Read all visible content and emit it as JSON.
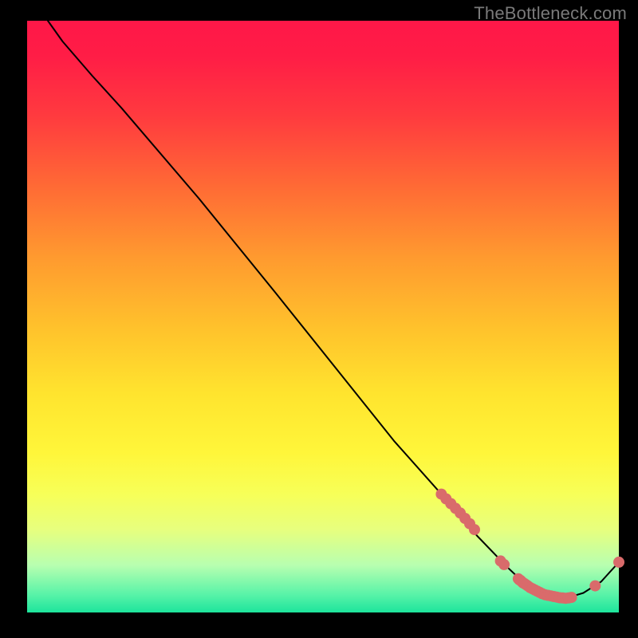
{
  "watermark": "TheBottleneck.com",
  "chart_data": {
    "type": "line",
    "title": "",
    "xlabel": "",
    "ylabel": "",
    "xlim": [
      0,
      100
    ],
    "ylim": [
      0,
      100
    ],
    "curve": [
      {
        "x": 3.5,
        "y": 100
      },
      {
        "x": 6,
        "y": 96.5
      },
      {
        "x": 11,
        "y": 90.7
      },
      {
        "x": 16,
        "y": 85.2
      },
      {
        "x": 29,
        "y": 70
      },
      {
        "x": 42,
        "y": 54
      },
      {
        "x": 54,
        "y": 39
      },
      {
        "x": 62,
        "y": 29
      },
      {
        "x": 70,
        "y": 20
      },
      {
        "x": 76,
        "y": 13
      },
      {
        "x": 81,
        "y": 7.8
      },
      {
        "x": 84.5,
        "y": 4.5
      },
      {
        "x": 88,
        "y": 2.8
      },
      {
        "x": 91,
        "y": 2.4
      },
      {
        "x": 94,
        "y": 3.3
      },
      {
        "x": 97,
        "y": 5.2
      },
      {
        "x": 100,
        "y": 8.5
      }
    ],
    "markers_pink": [
      {
        "x": 70.0,
        "y": 20.0
      },
      {
        "x": 70.8,
        "y": 19.2
      },
      {
        "x": 71.6,
        "y": 18.4
      },
      {
        "x": 72.4,
        "y": 17.6
      },
      {
        "x": 73.2,
        "y": 16.8
      },
      {
        "x": 74.0,
        "y": 15.9
      },
      {
        "x": 74.8,
        "y": 15.0
      },
      {
        "x": 75.6,
        "y": 14.0
      },
      {
        "x": 80.0,
        "y": 8.7
      },
      {
        "x": 80.6,
        "y": 8.1
      },
      {
        "x": 83.0,
        "y": 5.7
      },
      {
        "x": 83.2,
        "y": 5.5
      },
      {
        "x": 83.4,
        "y": 5.4
      },
      {
        "x": 83.6,
        "y": 5.2
      },
      {
        "x": 83.8,
        "y": 5.0
      },
      {
        "x": 84.0,
        "y": 4.9
      },
      {
        "x": 84.3,
        "y": 4.7
      },
      {
        "x": 84.6,
        "y": 4.5
      },
      {
        "x": 85.0,
        "y": 4.2
      },
      {
        "x": 85.4,
        "y": 4.0
      },
      {
        "x": 85.8,
        "y": 3.8
      },
      {
        "x": 86.2,
        "y": 3.6
      },
      {
        "x": 86.6,
        "y": 3.4
      },
      {
        "x": 87.0,
        "y": 3.2
      },
      {
        "x": 87.5,
        "y": 3.0
      },
      {
        "x": 88.0,
        "y": 2.9
      },
      {
        "x": 88.5,
        "y": 2.8
      },
      {
        "x": 89.0,
        "y": 2.7
      },
      {
        "x": 89.5,
        "y": 2.6
      },
      {
        "x": 90.0,
        "y": 2.5
      },
      {
        "x": 90.5,
        "y": 2.45
      },
      {
        "x": 91.0,
        "y": 2.4
      },
      {
        "x": 91.5,
        "y": 2.45
      },
      {
        "x": 92.0,
        "y": 2.55
      },
      {
        "x": 96.0,
        "y": 4.5
      },
      {
        "x": 100.0,
        "y": 8.5
      }
    ]
  }
}
